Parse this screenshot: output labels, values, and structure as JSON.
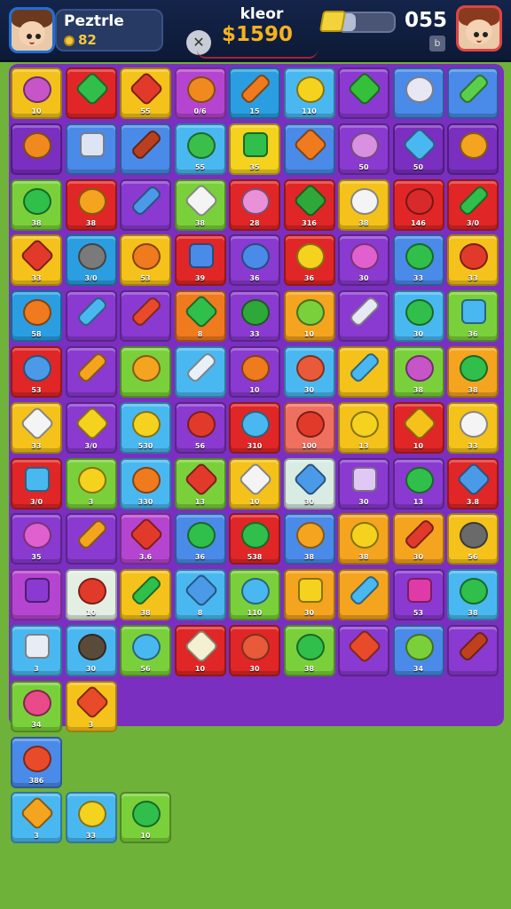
{
  "header": {
    "player_name": "Peztrle",
    "player_coins": "82",
    "center_label": "kleor",
    "center_score": "$1590",
    "counter": "055",
    "progress_fraction": 0.3,
    "small_button_glyph": "b",
    "tools_icon": "wrench-icon",
    "gem_icon": "gem-icon",
    "accent_score_color": "#f5b21e"
  },
  "board": {
    "columns": 9,
    "tiles": [
      {
        "r": 0,
        "c": 0,
        "bg": "#f2c21a",
        "piece": "#c855c8",
        "shape": "round",
        "label": "10"
      },
      {
        "r": 0,
        "c": 1,
        "bg": "#e02626",
        "piece": "#2fbf4a",
        "shape": "star",
        "label": ""
      },
      {
        "r": 0,
        "c": 2,
        "bg": "#f4c21a",
        "piece": "#e23a2a",
        "shape": "star",
        "label": "55"
      },
      {
        "r": 0,
        "c": 3,
        "bg": "#b545d0",
        "piece": "#f08a1e",
        "shape": "round",
        "label": "0/6"
      },
      {
        "r": 0,
        "c": 4,
        "bg": "#2a9ee0",
        "piece": "#f07a1e",
        "shape": "rod",
        "label": "15"
      },
      {
        "r": 0,
        "c": 5,
        "bg": "#4ab8f0",
        "piece": "#f4d21e",
        "shape": "round",
        "label": "110"
      },
      {
        "r": 0,
        "c": 6,
        "bg": "#8a3ad0",
        "piece": "#34c03a",
        "shape": "star",
        "label": ""
      },
      {
        "r": 0,
        "c": 7,
        "bg": "#4a8ae8",
        "piece": "#e8e8f4",
        "shape": "round",
        "label": ""
      },
      {
        "r": 0,
        "c": 8,
        "bg": "#4a8ae8",
        "piece": "#5ad04a",
        "shape": "rod",
        "label": ""
      },
      {
        "r": 1,
        "c": 0,
        "bg": "#7a2fc0",
        "piece": "#f08a1e",
        "shape": "round",
        "label": ""
      },
      {
        "r": 1,
        "c": 1,
        "bg": "#4a8ae8",
        "piece": "#dde4f4",
        "shape": "box",
        "label": ""
      },
      {
        "r": 1,
        "c": 2,
        "bg": "#4a8ae8",
        "piece": "#b8401e",
        "shape": "rod",
        "label": ""
      },
      {
        "r": 1,
        "c": 3,
        "bg": "#4ab8f0",
        "piece": "#3ac04a",
        "shape": "round",
        "label": "55"
      },
      {
        "r": 1,
        "c": 4,
        "bg": "#f4d21e",
        "piece": "#2fbf4a",
        "shape": "box",
        "label": "35"
      },
      {
        "r": 1,
        "c": 5,
        "bg": "#4a8ae8",
        "piece": "#f07a1e",
        "shape": "star",
        "label": ""
      },
      {
        "r": 1,
        "c": 6,
        "bg": "#8a3ad0",
        "piece": "#d890e0",
        "shape": "round",
        "label": "50"
      },
      {
        "r": 1,
        "c": 7,
        "bg": "#7a2fc0",
        "piece": "#4ab8f0",
        "shape": "star",
        "label": "50"
      },
      {
        "r": 1,
        "c": 8,
        "bg": "#7a2fc0",
        "piece": "#f4a41e",
        "shape": "round",
        "label": ""
      },
      {
        "r": 2,
        "c": 0,
        "bg": "#7ad03a",
        "piece": "#2fbf4a",
        "shape": "round",
        "label": "38"
      },
      {
        "r": 2,
        "c": 1,
        "bg": "#e02626",
        "piece": "#f4a41e",
        "shape": "round",
        "label": "38"
      },
      {
        "r": 2,
        "c": 2,
        "bg": "#8a3ad0",
        "piece": "#4a9ae8",
        "shape": "rod",
        "label": ""
      },
      {
        "r": 2,
        "c": 3,
        "bg": "#7ad03a",
        "piece": "#f4f4f4",
        "shape": "star",
        "label": "38"
      },
      {
        "r": 2,
        "c": 4,
        "bg": "#e02626",
        "piece": "#e890d8",
        "shape": "round",
        "label": "28"
      },
      {
        "r": 2,
        "c": 5,
        "bg": "#e02626",
        "piece": "#2fa83a",
        "shape": "star",
        "label": "316"
      },
      {
        "r": 2,
        "c": 6,
        "bg": "#f4c21a",
        "piece": "#f4f4f4",
        "shape": "round",
        "label": "38"
      },
      {
        "r": 2,
        "c": 7,
        "bg": "#e02626",
        "piece": "#d82a2a",
        "shape": "round",
        "label": "146"
      },
      {
        "r": 2,
        "c": 8,
        "bg": "#e02626",
        "piece": "#2fbf4a",
        "shape": "rod",
        "label": "3/0"
      },
      {
        "r": 3,
        "c": 0,
        "bg": "#f4c21a",
        "piece": "#e23a2a",
        "shape": "star",
        "label": "33"
      },
      {
        "r": 3,
        "c": 1,
        "bg": "#2a9ee0",
        "piece": "#7a7a7a",
        "shape": "round",
        "label": "3/0"
      },
      {
        "r": 3,
        "c": 2,
        "bg": "#f4c21a",
        "piece": "#f07a1e",
        "shape": "round",
        "label": "53"
      },
      {
        "r": 3,
        "c": 3,
        "bg": "#e02626",
        "piece": "#4a8ae8",
        "shape": "box",
        "label": "39"
      },
      {
        "r": 3,
        "c": 4,
        "bg": "#8a3ad0",
        "piece": "#4a8ae8",
        "shape": "round",
        "label": "36"
      },
      {
        "r": 3,
        "c": 5,
        "bg": "#e02626",
        "piece": "#f4d21e",
        "shape": "round",
        "label": "36"
      },
      {
        "r": 3,
        "c": 6,
        "bg": "#8a3ad0",
        "piece": "#e060d0",
        "shape": "round",
        "label": "30"
      },
      {
        "r": 3,
        "c": 7,
        "bg": "#4a8ae8",
        "piece": "#2fbf4a",
        "shape": "round",
        "label": "33"
      },
      {
        "r": 3,
        "c": 8,
        "bg": "#f4c21a",
        "piece": "#e23a2a",
        "shape": "round",
        "label": "33"
      },
      {
        "r": 4,
        "c": 0,
        "bg": "#2a9ee0",
        "piece": "#f07a1e",
        "shape": "round",
        "label": "58"
      },
      {
        "r": 4,
        "c": 1,
        "bg": "#8a3ad0",
        "piece": "#4ab8f0",
        "shape": "rod",
        "label": ""
      },
      {
        "r": 4,
        "c": 2,
        "bg": "#8a3ad0",
        "piece": "#e84a2a",
        "shape": "rod",
        "label": ""
      },
      {
        "r": 4,
        "c": 3,
        "bg": "#f07a1e",
        "piece": "#2fbf4a",
        "shape": "star",
        "label": "8"
      },
      {
        "r": 4,
        "c": 4,
        "bg": "#8a3ad0",
        "piece": "#2fa83a",
        "shape": "round",
        "label": "33"
      },
      {
        "r": 4,
        "c": 5,
        "bg": "#f4a41e",
        "piece": "#7ad03a",
        "shape": "round",
        "label": "10"
      },
      {
        "r": 4,
        "c": 6,
        "bg": "#8a3ad0",
        "piece": "#e8e8f4",
        "shape": "rod",
        "label": ""
      },
      {
        "r": 4,
        "c": 7,
        "bg": "#4ab8f0",
        "piece": "#2fbf4a",
        "shape": "round",
        "label": "30"
      },
      {
        "r": 4,
        "c": 8,
        "bg": "#7ad03a",
        "piece": "#4ab8f0",
        "shape": "box",
        "label": "36"
      },
      {
        "r": 5,
        "c": 0,
        "bg": "#e02626",
        "piece": "#4a9ae8",
        "shape": "round",
        "label": "53"
      },
      {
        "r": 5,
        "c": 1,
        "bg": "#8a3ad0",
        "piece": "#f4a41e",
        "shape": "rod",
        "label": ""
      },
      {
        "r": 5,
        "c": 2,
        "bg": "#7ad03a",
        "piece": "#f4a41e",
        "shape": "round",
        "label": ""
      },
      {
        "r": 5,
        "c": 3,
        "bg": "#4ab8f0",
        "piece": "#e8f0f8",
        "shape": "rod",
        "label": ""
      },
      {
        "r": 5,
        "c": 4,
        "bg": "#8a3ad0",
        "piece": "#f07a1e",
        "shape": "round",
        "label": "10"
      },
      {
        "r": 5,
        "c": 5,
        "bg": "#4ab8f0",
        "piece": "#e85a3a",
        "shape": "round",
        "label": "30"
      },
      {
        "r": 5,
        "c": 6,
        "bg": "#f4c21a",
        "piece": "#4ab8f0",
        "shape": "rod",
        "label": ""
      },
      {
        "r": 5,
        "c": 7,
        "bg": "#7ad03a",
        "piece": "#c855c8",
        "shape": "round",
        "label": "38"
      },
      {
        "r": 5,
        "c": 8,
        "bg": "#f4a41e",
        "piece": "#2fbf4a",
        "shape": "round",
        "label": "38"
      },
      {
        "r": 6,
        "c": 0,
        "bg": "#f4c21a",
        "piece": "#f4f4f4",
        "shape": "star",
        "label": "33"
      },
      {
        "r": 6,
        "c": 1,
        "bg": "#8a3ad0",
        "piece": "#f4d21e",
        "shape": "star",
        "label": "3/0"
      },
      {
        "r": 6,
        "c": 2,
        "bg": "#4ab8f0",
        "piece": "#f4d21e",
        "shape": "round",
        "label": "530"
      },
      {
        "r": 6,
        "c": 3,
        "bg": "#8a3ad0",
        "piece": "#e23a2a",
        "shape": "round",
        "label": "56"
      },
      {
        "r": 6,
        "c": 4,
        "bg": "#e02626",
        "piece": "#4ab8f0",
        "shape": "round",
        "label": "310"
      },
      {
        "r": 6,
        "c": 5,
        "bg": "#f07060",
        "piece": "#e23a2a",
        "shape": "round",
        "label": "100"
      },
      {
        "r": 6,
        "c": 6,
        "bg": "#f4c21a",
        "piece": "#f4d21e",
        "shape": "round",
        "label": "13"
      },
      {
        "r": 6,
        "c": 7,
        "bg": "#e02626",
        "piece": "#f4c21a",
        "shape": "star",
        "label": "10"
      },
      {
        "r": 6,
        "c": 8,
        "bg": "#f4c21a",
        "piece": "#f4f4f4",
        "shape": "round",
        "label": "33"
      },
      {
        "r": 7,
        "c": 0,
        "bg": "#e02626",
        "piece": "#4ab8f0",
        "shape": "box",
        "label": "3/0"
      },
      {
        "r": 7,
        "c": 1,
        "bg": "#7ad03a",
        "piece": "#f4d21e",
        "shape": "round",
        "label": "3"
      },
      {
        "r": 7,
        "c": 2,
        "bg": "#4ab8f0",
        "piece": "#f07a1e",
        "shape": "round",
        "label": "330"
      },
      {
        "r": 7,
        "c": 3,
        "bg": "#7ad03a",
        "piece": "#e23a2a",
        "shape": "star",
        "label": "13"
      },
      {
        "r": 7,
        "c": 4,
        "bg": "#f4c21a",
        "piece": "#f4f4f4",
        "shape": "star",
        "label": "10"
      },
      {
        "r": 7,
        "c": 5,
        "bg": "#d8ece4",
        "piece": "#4a9ae8",
        "shape": "star",
        "label": "30"
      },
      {
        "r": 7,
        "c": 6,
        "bg": "#8a3ad0",
        "piece": "#e0c8f4",
        "shape": "box",
        "label": "30"
      },
      {
        "r": 7,
        "c": 7,
        "bg": "#8a3ad0",
        "piece": "#2fbf4a",
        "shape": "round",
        "label": "13"
      },
      {
        "r": 7,
        "c": 8,
        "bg": "#e02626",
        "piece": "#4a9ae8",
        "shape": "star",
        "label": "3.8"
      },
      {
        "r": 8,
        "c": 0,
        "bg": "#8a3ad0",
        "piece": "#e060d0",
        "shape": "round",
        "label": "35"
      },
      {
        "r": 8,
        "c": 1,
        "bg": "#8a3ad0",
        "piece": "#f4a41e",
        "shape": "rod",
        "label": ""
      },
      {
        "r": 8,
        "c": 2,
        "bg": "#b545d0",
        "piece": "#e23a2a",
        "shape": "star",
        "label": "3.6"
      },
      {
        "r": 8,
        "c": 3,
        "bg": "#4a8ae8",
        "piece": "#2fbf4a",
        "shape": "round",
        "label": "36"
      },
      {
        "r": 8,
        "c": 4,
        "bg": "#e02626",
        "piece": "#2fbf4a",
        "shape": "round",
        "label": "538"
      },
      {
        "r": 8,
        "c": 5,
        "bg": "#4a8ae8",
        "piece": "#f4a41e",
        "shape": "round",
        "label": "38"
      },
      {
        "r": 8,
        "c": 6,
        "bg": "#f4a41e",
        "piece": "#f4d21e",
        "shape": "round",
        "label": "38"
      },
      {
        "r": 8,
        "c": 7,
        "bg": "#f4a41e",
        "piece": "#e23a2a",
        "shape": "rod",
        "label": "30"
      },
      {
        "r": 8,
        "c": 8,
        "bg": "#f4c21a",
        "piece": "#6a6a6a",
        "shape": "round",
        "label": "56"
      },
      {
        "r": 9,
        "c": 0,
        "bg": "#b545d0",
        "piece": "#8a3ad0",
        "shape": "box",
        "label": ""
      },
      {
        "r": 9,
        "c": 1,
        "bg": "#e4efe4",
        "piece": "#e23a2a",
        "shape": "round",
        "label": "10"
      },
      {
        "r": 9,
        "c": 2,
        "bg": "#f4c21a",
        "piece": "#2fbf4a",
        "shape": "rod",
        "label": "38"
      },
      {
        "r": 9,
        "c": 3,
        "bg": "#4ab8f0",
        "piece": "#4a9ae8",
        "shape": "star",
        "label": "8"
      },
      {
        "r": 9,
        "c": 4,
        "bg": "#7ad03a",
        "piece": "#4ab8f0",
        "shape": "round",
        "label": "110"
      },
      {
        "r": 9,
        "c": 5,
        "bg": "#f4a41e",
        "piece": "#f4d21e",
        "shape": "box",
        "label": "30"
      },
      {
        "r": 9,
        "c": 6,
        "bg": "#f4a41e",
        "piece": "#4ab8f0",
        "shape": "rod",
        "label": ""
      },
      {
        "r": 9,
        "c": 7,
        "bg": "#8a3ad0",
        "piece": "#e03aa8",
        "shape": "box",
        "label": "53"
      },
      {
        "r": 9,
        "c": 8,
        "bg": "#4ab8f0",
        "piece": "#2fbf4a",
        "shape": "round",
        "label": "38"
      },
      {
        "r": 10,
        "c": 0,
        "bg": "#4ab8f0",
        "piece": "#e8ecf4",
        "shape": "box",
        "label": "3"
      },
      {
        "r": 10,
        "c": 1,
        "bg": "#4ab8f0",
        "piece": "#5a4a3a",
        "shape": "round",
        "label": "30"
      },
      {
        "r": 10,
        "c": 2,
        "bg": "#7ad03a",
        "piece": "#4ab8f0",
        "shape": "round",
        "label": "56"
      },
      {
        "r": 10,
        "c": 3,
        "bg": "#e02626",
        "piece": "#f4f0d0",
        "shape": "star",
        "label": "10"
      },
      {
        "r": 10,
        "c": 4,
        "bg": "#e02626",
        "piece": "#e85a3a",
        "shape": "round",
        "label": "30"
      },
      {
        "r": 10,
        "c": 5,
        "bg": "#7ad03a",
        "piece": "#2fbf4a",
        "shape": "round",
        "label": "38"
      },
      {
        "r": 10,
        "c": 6,
        "bg": "#8a3ad0",
        "piece": "#e84a2a",
        "shape": "star",
        "label": ""
      },
      {
        "r": 10,
        "c": 7,
        "bg": "#4a8ae8",
        "piece": "#7ad03a",
        "shape": "round",
        "label": "34"
      },
      {
        "r": 10,
        "c": 8,
        "bg": "#8a3ad0",
        "piece": "#c0401e",
        "shape": "rod",
        "label": ""
      },
      {
        "r": 11,
        "c": 0,
        "bg": "#7ad03a",
        "piece": "#e84a8a",
        "shape": "round",
        "label": "34"
      },
      {
        "r": 11,
        "c": 1,
        "bg": "#f4c21a",
        "piece": "#e84a2a",
        "shape": "star",
        "label": "3"
      },
      {
        "r": 12,
        "c": 0,
        "bg": "#4a8ae8",
        "piece": "#e84a2a",
        "shape": "round",
        "label": "386"
      },
      {
        "r": 13,
        "c": 0,
        "bg": "#4ab8f0",
        "piece": "#f4a41e",
        "shape": "star",
        "label": "3"
      },
      {
        "r": 13,
        "c": 1,
        "bg": "#4ab8f0",
        "piece": "#f4d21e",
        "shape": "round",
        "label": "33"
      },
      {
        "r": 13,
        "c": 2,
        "bg": "#7ad03a",
        "piece": "#2fbf4a",
        "shape": "round",
        "label": "10"
      }
    ]
  }
}
